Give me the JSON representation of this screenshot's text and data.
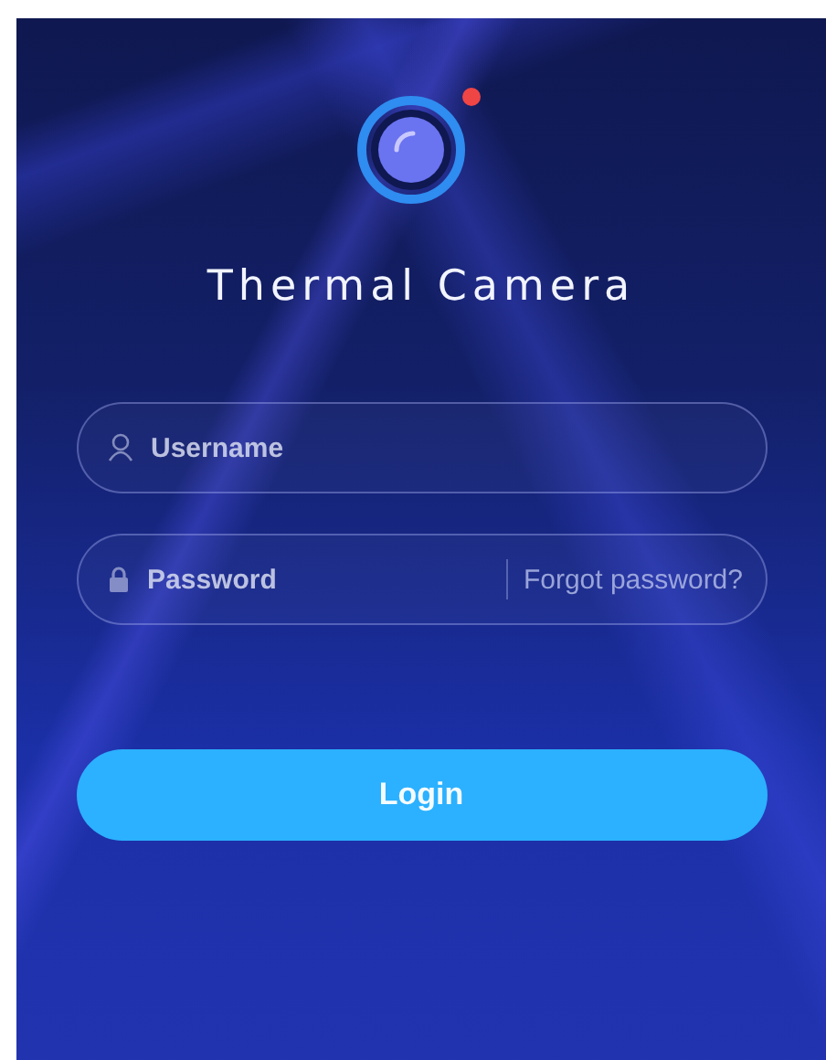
{
  "app": {
    "title": "Thermal Camera"
  },
  "username": {
    "placeholder": "Username"
  },
  "password": {
    "placeholder": "Password",
    "forgot_link": "Forgot password?"
  },
  "login_button": "Login"
}
